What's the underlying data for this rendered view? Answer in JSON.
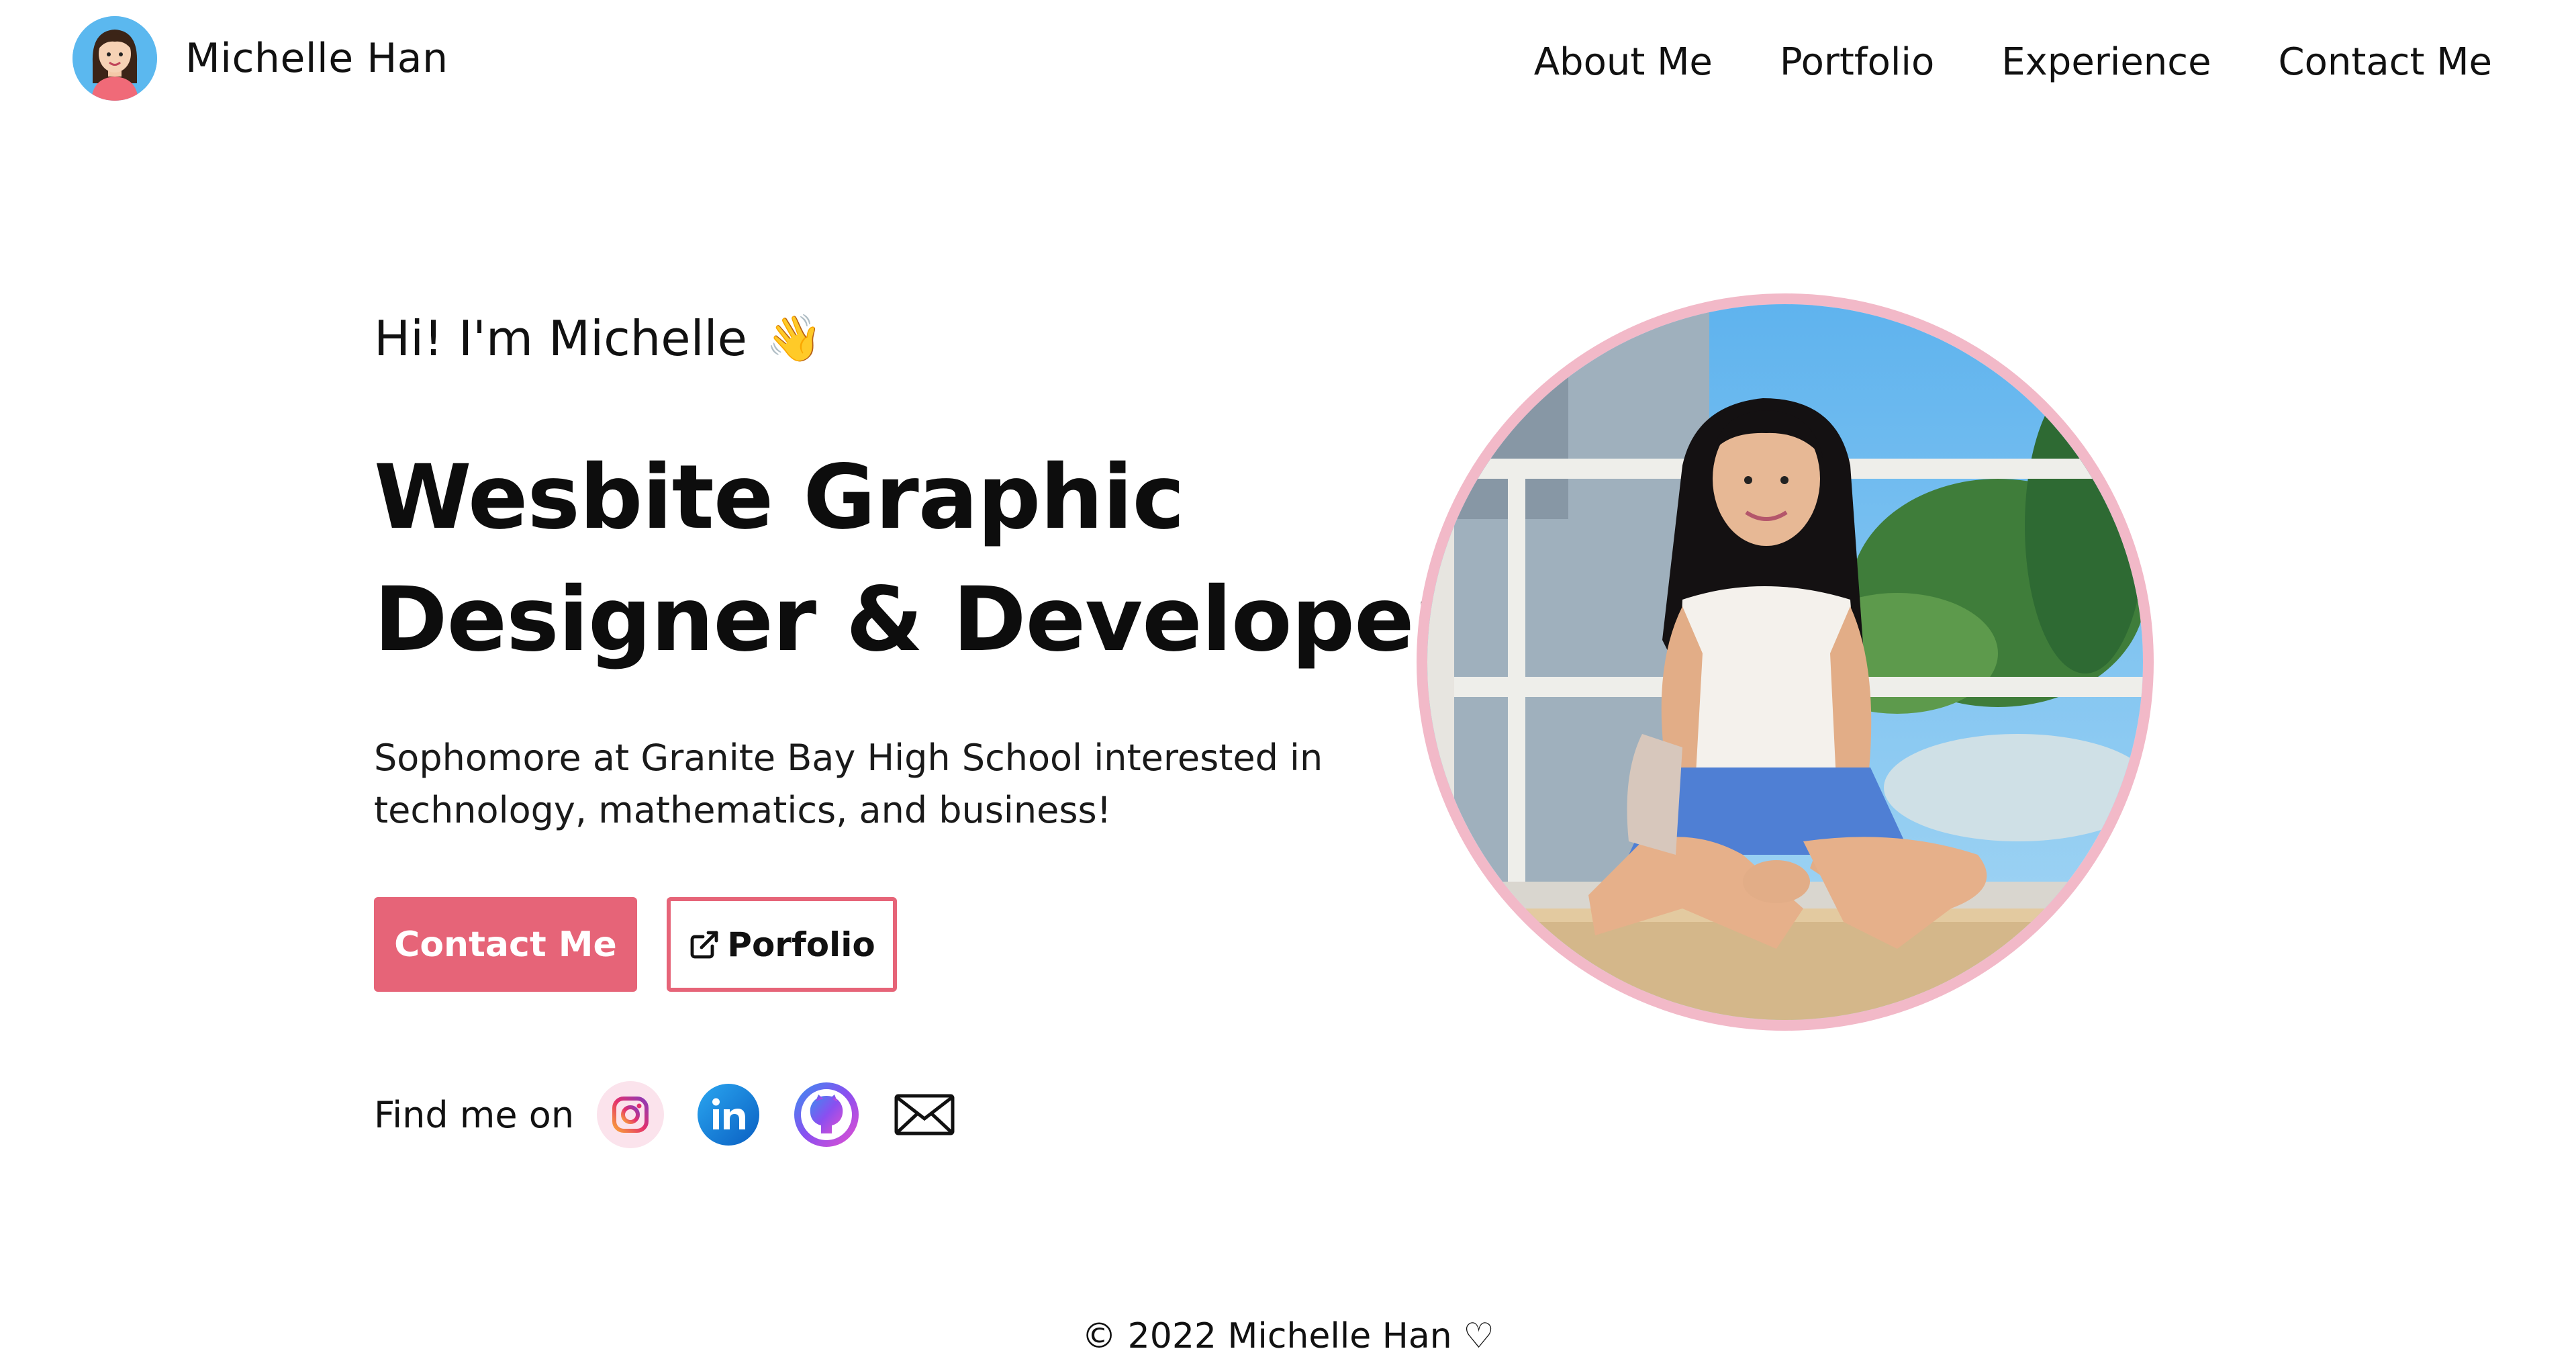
{
  "header": {
    "brand_name": "Michelle Han",
    "nav": [
      "About Me",
      "Portfolio",
      "Experience",
      "Contact Me"
    ]
  },
  "hero": {
    "greeting": "Hi! I'm Michelle",
    "greeting_emoji": "👋",
    "headline_line1": "Wesbite Graphic",
    "headline_line2": "Designer & Developer",
    "bio_line1": "Sophomore at Granite Bay High School interested in",
    "bio_line2": "technology, mathematics, and business!",
    "primary_button": "Contact Me",
    "secondary_button": "Porfolio",
    "secondary_button_icon": "external-link-icon"
  },
  "social": {
    "label": "Find me on",
    "icons": [
      "instagram-icon",
      "linkedin-icon",
      "github-icon",
      "mail-icon"
    ]
  },
  "footer": {
    "copyright": "© 2022 Michelle Han ♡"
  },
  "colors": {
    "accent": "#e66478",
    "portrait_ring": "#f2b9c8",
    "linkedin": "#0a66c2",
    "text": "#111111"
  }
}
